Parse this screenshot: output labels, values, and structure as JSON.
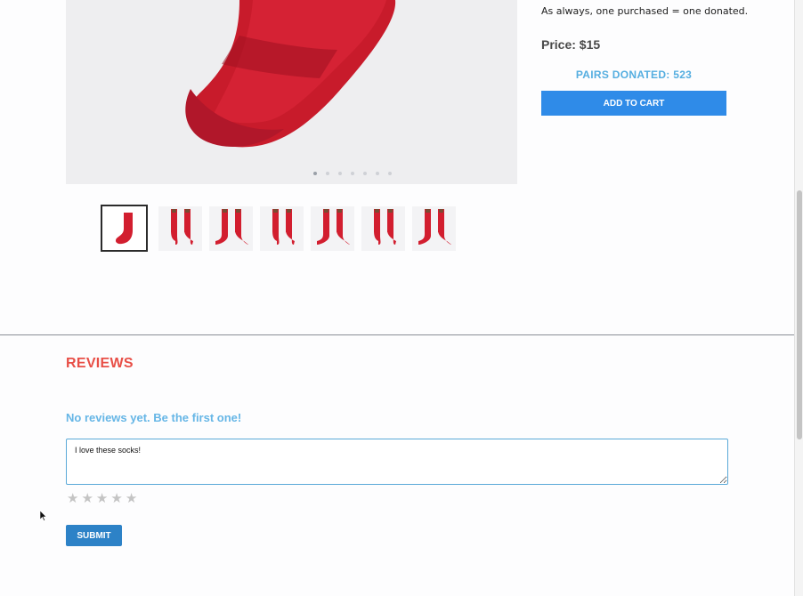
{
  "product": {
    "tagline": "As always, one purchased = one donated.",
    "price_label": "Price: $15",
    "pairs_donated": "PAIRS DONATED: 523",
    "add_to_cart_label": "ADD TO CART",
    "image_alt": "red sock",
    "carousel": {
      "slide_count": 7,
      "active_index": 0
    },
    "thumbnails": [
      "single sock",
      "pair of socks on feet",
      "pair of socks on feet",
      "pair of socks on feet",
      "pair of socks on feet",
      "pair of socks on feet",
      "pair of socks on feet"
    ],
    "sock_color": "#d21e2f"
  },
  "reviews": {
    "title": "REVIEWS",
    "empty_message": "No reviews yet. Be the first one!",
    "textarea_value": "I love these socks!",
    "rating_stars": 5,
    "rating_value": 0,
    "submit_label": "SUBMIT"
  },
  "colors": {
    "accent_blue": "#2f8be8",
    "reviews_red": "#e84f47",
    "light_blue_text": "#55aee0"
  }
}
